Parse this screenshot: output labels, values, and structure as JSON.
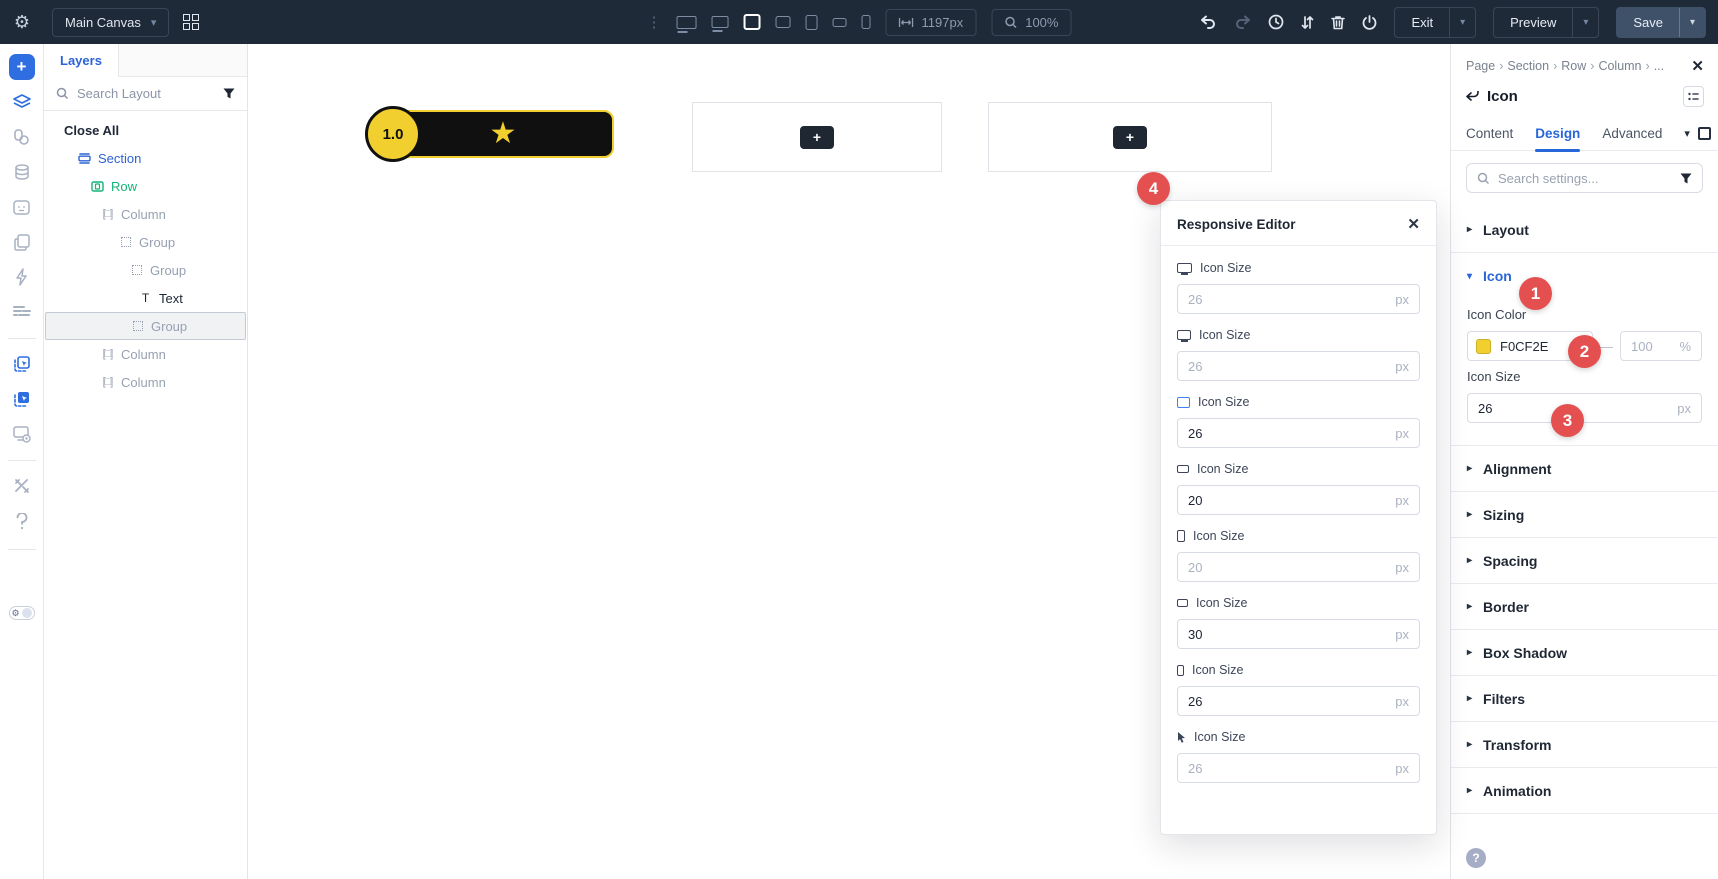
{
  "topbar": {
    "canvas_selector_label": "Main Canvas",
    "width_field": "1197px",
    "zoom_field": "100%",
    "exit_label": "Exit",
    "preview_label": "Preview",
    "save_label": "Save"
  },
  "layers_panel": {
    "tab_label": "Layers",
    "search_placeholder": "Search Layout",
    "close_all_label": "Close All",
    "tree": [
      {
        "label": "Section"
      },
      {
        "label": "Row"
      },
      {
        "label": "Column"
      },
      {
        "label": "Group"
      },
      {
        "label": "Group"
      },
      {
        "label": "Text"
      },
      {
        "label": "Group"
      },
      {
        "label": "Column"
      },
      {
        "label": "Column"
      }
    ]
  },
  "canvas": {
    "rating_value": "1.0"
  },
  "responsive_editor": {
    "title": "Responsive Editor",
    "fields": [
      {
        "label": "Icon Size",
        "value": "26",
        "unit": "px",
        "state": "placeholder",
        "device": "desktop"
      },
      {
        "label": "Icon Size",
        "value": "26",
        "unit": "px",
        "state": "placeholder",
        "device": "desktop-small"
      },
      {
        "label": "Icon Size",
        "value": "26",
        "unit": "px",
        "state": "set",
        "device": "tablet-landscape-active"
      },
      {
        "label": "Icon Size",
        "value": "20",
        "unit": "px",
        "state": "set",
        "device": "tablet-landscape"
      },
      {
        "label": "Icon Size",
        "value": "20",
        "unit": "px",
        "state": "placeholder",
        "device": "tablet-portrait"
      },
      {
        "label": "Icon Size",
        "value": "30",
        "unit": "px",
        "state": "set",
        "device": "phone-landscape"
      },
      {
        "label": "Icon Size",
        "value": "26",
        "unit": "px",
        "state": "set",
        "device": "phone-portrait"
      },
      {
        "label": "Icon Size",
        "value": "26",
        "unit": "px",
        "state": "placeholder",
        "device": "cursor"
      }
    ]
  },
  "inspector": {
    "breadcrumb": [
      "Page",
      "Section",
      "Row",
      "Column",
      "..."
    ],
    "breadcrumb_separator": "›",
    "element_title": "Icon",
    "tabs": {
      "content": "Content",
      "design": "Design",
      "advanced": "Advanced"
    },
    "search_placeholder": "Search settings...",
    "layout_section_label": "Layout",
    "icon_section": {
      "title": "Icon",
      "icon_color_label": "Icon Color",
      "color_hex": "F0CF2E",
      "color_swatch": "#F0CF2E",
      "dash": "—",
      "opacity_placeholder": "100",
      "opacity_unit": "%",
      "icon_size_label": "Icon Size",
      "icon_size_value": "26",
      "icon_size_unit": "px"
    },
    "collapsed_sections": [
      {
        "label": "Alignment"
      },
      {
        "label": "Sizing"
      },
      {
        "label": "Spacing"
      },
      {
        "label": "Border"
      },
      {
        "label": "Box Shadow"
      },
      {
        "label": "Filters"
      },
      {
        "label": "Transform"
      },
      {
        "label": "Animation"
      }
    ],
    "help_label": "?"
  },
  "annotations": {
    "badge1": "1",
    "badge2": "2",
    "badge3": "3",
    "badge4": "4"
  },
  "colors": {
    "accent_yellow": "#F0CF2E",
    "badge_red": "#E44F4F",
    "accent_blue": "#2767D9"
  }
}
